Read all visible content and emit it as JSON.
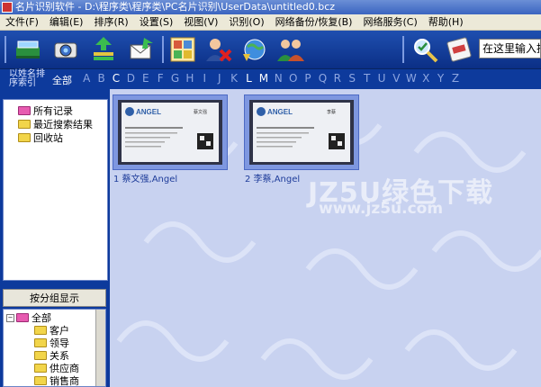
{
  "window": {
    "title": "名片识别软件 - D:\\程序类\\程序类\\PC名片识别\\UserData\\untitled0.bcz"
  },
  "menu": {
    "items": [
      "文件(F)",
      "编辑(E)",
      "排序(R)",
      "设置(S)",
      "视图(V)",
      "识别(O)",
      "网络备份/恢复(B)",
      "网络服务(C)",
      "帮助(H)"
    ]
  },
  "toolbar": {
    "search_placeholder": "在这里输入搜索"
  },
  "alphabar": {
    "sort_label": "以姓名排序索引",
    "all_label": "全部",
    "letters": [
      "A",
      "B",
      "C",
      "D",
      "E",
      "F",
      "G",
      "H",
      "I",
      "J",
      "K",
      "L",
      "M",
      "N",
      "O",
      "P",
      "Q",
      "R",
      "S",
      "T",
      "U",
      "V",
      "W",
      "X",
      "Y",
      "Z"
    ],
    "active_letters": [
      "C",
      "L",
      "M"
    ]
  },
  "tree": {
    "items": [
      "所有记录",
      "最近搜索结果",
      "回收站"
    ]
  },
  "groups": {
    "header": "按分组显示",
    "root": "全部",
    "items": [
      "客户",
      "领导",
      "关系",
      "供应商",
      "销售商"
    ]
  },
  "cards": [
    {
      "label": "1 蔡文强,Angel",
      "brand": "ANGEL",
      "name": "蔡文强"
    },
    {
      "label": "2 李蔡,Angel",
      "brand": "ANGEL",
      "name": "李蔡"
    }
  ],
  "watermark": {
    "main": "JZ5U绿色下载",
    "sub": "www.jz5u.com"
  },
  "colors": {
    "toolbar": "#1f4fb0",
    "alphabar": "#0d3a9c",
    "content_bg": "#c8d2f0",
    "card_frame": "#7e97e0"
  }
}
